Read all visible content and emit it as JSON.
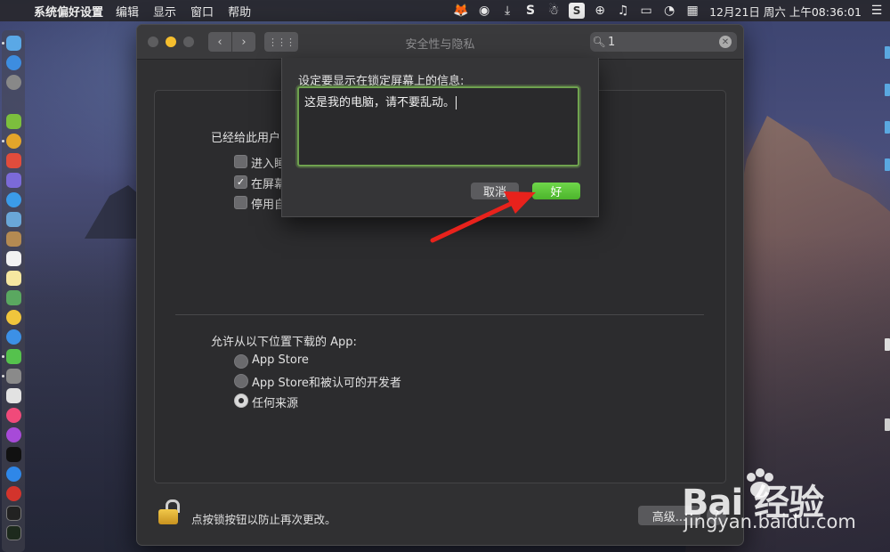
{
  "menubar": {
    "apple_glyph": "",
    "app_name": "系统偏好设置",
    "menus": [
      "编辑",
      "显示",
      "窗口",
      "帮助"
    ],
    "status_icons": [
      "gitlab-icon",
      "sync-icon",
      "download-icon",
      "s-app-icon",
      "qq-icon",
      "sogou-icon",
      "globe-icon",
      "music-icon",
      "airplay-icon",
      "speed-icon"
    ],
    "clock": "12月21日 周六 上午08:36:01"
  },
  "window": {
    "title": "安全性与隐私",
    "search_value": "1",
    "nav_back": "‹",
    "nav_fwd": "›",
    "grid": "⋮⋮⋮"
  },
  "general": {
    "heading": "已经给此用户",
    "options": [
      {
        "label": "进入睡",
        "checked": false
      },
      {
        "label": "在屏幕",
        "checked": true
      },
      {
        "label": "停用自",
        "checked": false
      }
    ]
  },
  "downloads": {
    "heading": "允许从以下位置下载的 App:",
    "options": [
      {
        "label": "App Store",
        "selected": false
      },
      {
        "label": "App Store和被认可的开发者",
        "selected": false
      },
      {
        "label": "任何来源",
        "selected": true
      }
    ]
  },
  "footer": {
    "lock_text": "点按锁按钮以防止再次更改。",
    "advanced_label": "高级...",
    "help_label": "?"
  },
  "sheet": {
    "prompt": "设定要显示在锁定屏幕上的信息:",
    "message": "这是我的电脑，请不要乱动。",
    "cancel_label": "取消",
    "ok_label": "好"
  },
  "watermark": {
    "logo": "Bai  经验",
    "url": "jingyan.baidu.com"
  },
  "colors": {
    "ok_button": "#4cb52c",
    "focus_ring": "#6fa24f",
    "arrow": "#e8221c",
    "lock": "#e0b033"
  }
}
